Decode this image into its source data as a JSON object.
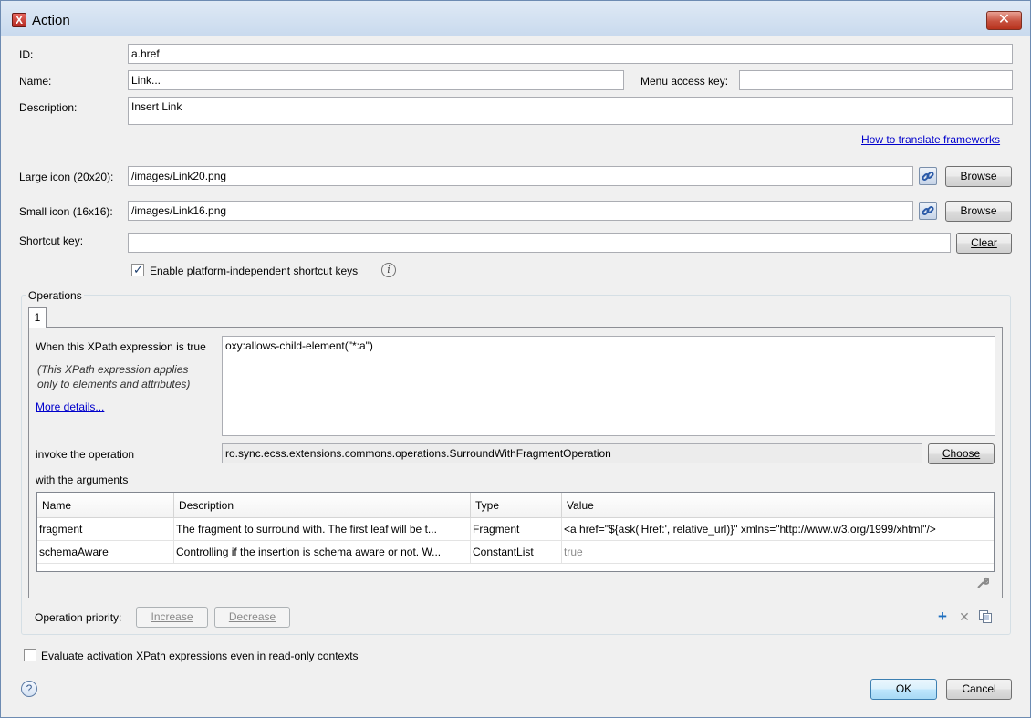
{
  "window": {
    "title": "Action",
    "close_glyph": "✕"
  },
  "form": {
    "id_label": "ID:",
    "id_value": "a.href",
    "name_label": "Name:",
    "name_value": "Link...",
    "menu_key_label": "Menu access key:",
    "menu_key_value": "",
    "description_label": "Description:",
    "description_value": "Insert Link",
    "translate_link": "How to translate frameworks",
    "large_icon_label": "Large icon (20x20):",
    "large_icon_value": "/images/Link20.png",
    "small_icon_label": "Small icon (16x16):",
    "small_icon_value": "/images/Link16.png",
    "browse_label": "Browse",
    "shortcut_label": "Shortcut key:",
    "shortcut_value": "",
    "clear_label": "Clear",
    "platform_shortcut_label": "Enable platform-independent shortcut keys",
    "platform_shortcut_checked": true
  },
  "operations": {
    "group_title": "Operations",
    "tabs": [
      "1"
    ],
    "xpath_label": "When this XPath expression is true",
    "xpath_value": "oxy:allows-child-element(\"*:a\")",
    "note_line1": "(This XPath expression applies",
    "note_line2": "only to elements and attributes)",
    "more_details": "More details...",
    "invoke_label": "invoke the operation",
    "operation_value": "ro.sync.ecss.extensions.commons.operations.SurroundWithFragmentOperation",
    "choose_label": "Choose",
    "args_label": "with the arguments",
    "columns": [
      "Name",
      "Description",
      "Type",
      "Value"
    ],
    "rows": [
      {
        "name": "fragment",
        "description": "The fragment to surround with. The first leaf will be t...",
        "type": "Fragment",
        "value": "<a href=\"${ask('Href:', relative_url)}\" xmlns=\"http://www.w3.org/1999/xhtml\"/>"
      },
      {
        "name": "schemaAware",
        "description": "Controlling if the insertion is schema aware or not. W...",
        "type": "ConstantList",
        "value": "true"
      }
    ],
    "priority_label": "Operation priority:",
    "increase_label": "Increase",
    "decrease_label": "Decrease"
  },
  "footer": {
    "readonly_label": "Evaluate activation XPath expressions even in read-only contexts",
    "readonly_checked": false,
    "help_glyph": "?",
    "ok_label": "OK",
    "cancel_label": "Cancel"
  },
  "icons": {
    "app": "oxygen-x-icon",
    "link": "link-icon",
    "info": "info-icon",
    "wrench": "wrench-icon",
    "add": "add-icon",
    "remove": "remove-icon",
    "copy": "copy-icon",
    "help": "help-icon"
  },
  "colors": {
    "link": "#0000cc",
    "accent": "#3c7fb1",
    "close": "#c7503d"
  }
}
